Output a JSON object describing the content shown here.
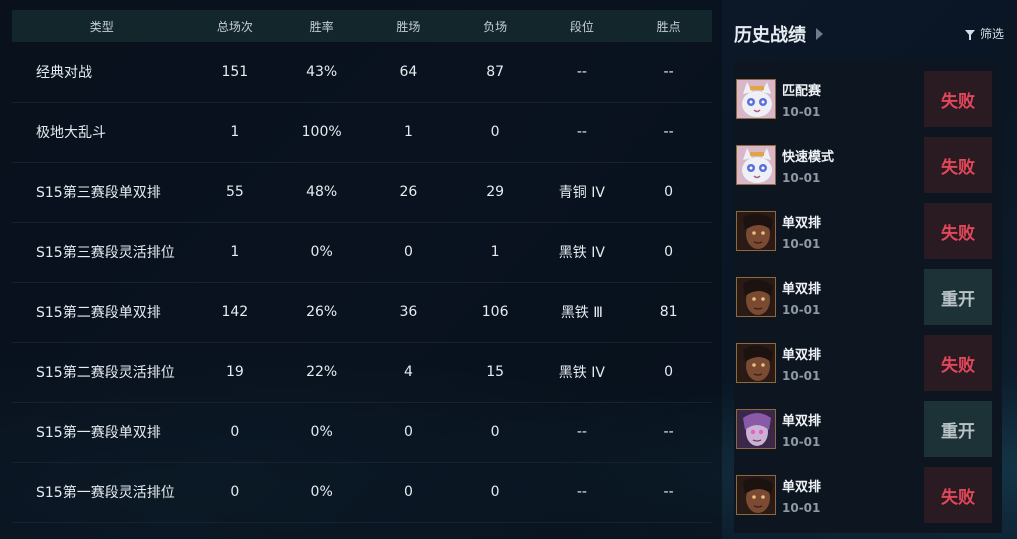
{
  "stats": {
    "headers": [
      "类型",
      "总场次",
      "胜率",
      "胜场",
      "负场",
      "段位",
      "胜点"
    ],
    "rows": [
      {
        "mode": "经典对战",
        "total": "151",
        "winrate": "43%",
        "wins": "64",
        "losses": "87",
        "rank": "--",
        "lp": "--"
      },
      {
        "mode": "极地大乱斗",
        "total": "1",
        "winrate": "100%",
        "wins": "1",
        "losses": "0",
        "rank": "--",
        "lp": "--"
      },
      {
        "mode": "S15第三赛段单双排",
        "total": "55",
        "winrate": "48%",
        "wins": "26",
        "losses": "29",
        "rank": "青铜 IV",
        "lp": "0"
      },
      {
        "mode": "S15第三赛段灵活排位",
        "total": "1",
        "winrate": "0%",
        "wins": "0",
        "losses": "1",
        "rank": "黑铁 IV",
        "lp": "0"
      },
      {
        "mode": "S15第二赛段单双排",
        "total": "142",
        "winrate": "26%",
        "wins": "36",
        "losses": "106",
        "rank": "黑铁 Ⅲ",
        "lp": "81"
      },
      {
        "mode": "S15第二赛段灵活排位",
        "total": "19",
        "winrate": "22%",
        "wins": "4",
        "losses": "15",
        "rank": "黑铁 IV",
        "lp": "0"
      },
      {
        "mode": "S15第一赛段单双排",
        "total": "0",
        "winrate": "0%",
        "wins": "0",
        "losses": "0",
        "rank": "--",
        "lp": "--"
      },
      {
        "mode": "S15第一赛段灵活排位",
        "total": "0",
        "winrate": "0%",
        "wins": "0",
        "losses": "0",
        "rank": "--",
        "lp": "--"
      }
    ]
  },
  "history": {
    "title": "历史战绩",
    "filter_label": "筛选",
    "matches": [
      {
        "mode": "匹配赛",
        "date": "10-01",
        "result": "失败",
        "type": "lose",
        "avatar": "yuumi-icon"
      },
      {
        "mode": "快速模式",
        "date": "10-01",
        "result": "失败",
        "type": "lose",
        "avatar": "yuumi-icon"
      },
      {
        "mode": "单双排",
        "date": "10-01",
        "result": "失败",
        "type": "lose",
        "avatar": "champion-dark-icon"
      },
      {
        "mode": "单双排",
        "date": "10-01",
        "result": "重开",
        "type": "remake",
        "avatar": "champion-dark-icon"
      },
      {
        "mode": "单双排",
        "date": "10-01",
        "result": "失败",
        "type": "lose",
        "avatar": "champion-dark-icon"
      },
      {
        "mode": "单双排",
        "date": "10-01",
        "result": "重开",
        "type": "remake",
        "avatar": "champion-purple-icon"
      },
      {
        "mode": "单双排",
        "date": "10-01",
        "result": "失败",
        "type": "lose",
        "avatar": "champion-dark-icon"
      }
    ]
  },
  "colors": {
    "lose": "#e2485a",
    "remake": "#b9c3c8",
    "header_bg": "#13262c"
  }
}
